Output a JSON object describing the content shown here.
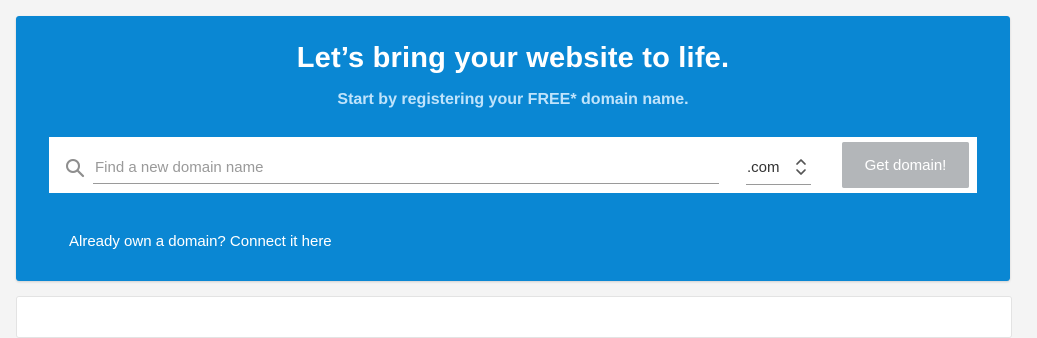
{
  "hero": {
    "headline": "Let’s bring your website to life.",
    "subheadline": "Start by registering your FREE* domain name."
  },
  "search": {
    "icon": "search-icon",
    "placeholder": "Find a new domain name",
    "value": "",
    "tld": {
      "selected": ".com",
      "icon": "chevron-up-down-icon"
    },
    "submit_label": "Get domain!"
  },
  "connect_link": "Already own a domain? Connect it here",
  "colors": {
    "panel_background": "#0a87d3",
    "subheadline": "#bfe3fb",
    "button_disabled": "#b3b6b9",
    "page_background": "#f4f4f4"
  }
}
